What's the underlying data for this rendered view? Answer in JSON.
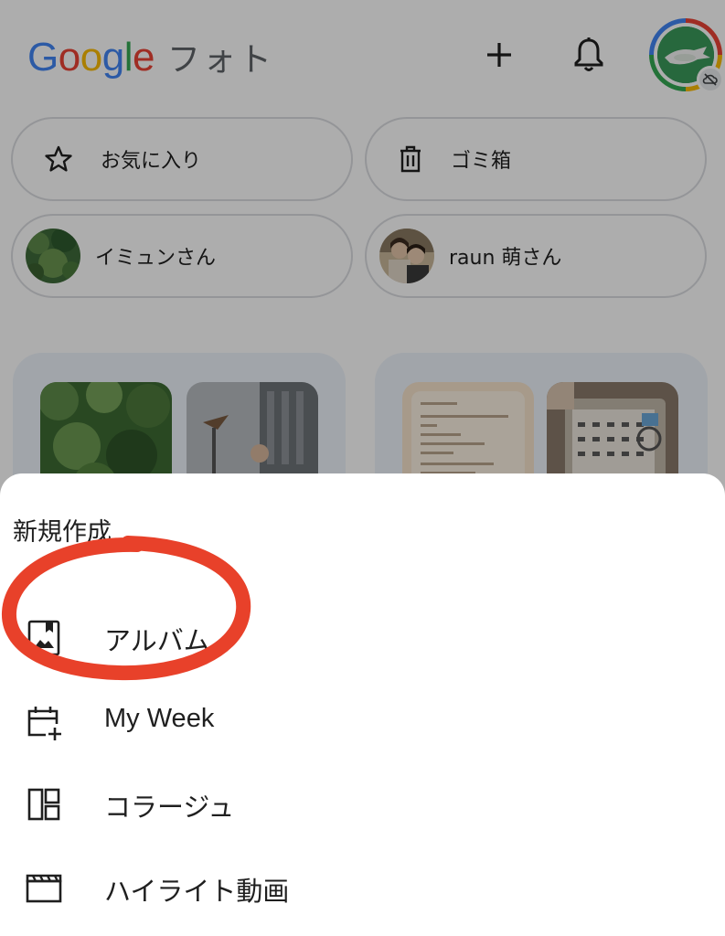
{
  "header": {
    "logo": {
      "letters": [
        {
          "ch": "G",
          "color": "#4285f4"
        },
        {
          "ch": "o",
          "color": "#ea4335"
        },
        {
          "ch": "o",
          "color": "#fbbc05"
        },
        {
          "ch": "g",
          "color": "#4285f4"
        },
        {
          "ch": "l",
          "color": "#34a853"
        },
        {
          "ch": "e",
          "color": "#ea4335"
        }
      ],
      "suffix": "フォト"
    },
    "add_icon": "plus-icon",
    "notifications_icon": "bell-icon"
  },
  "chips": {
    "favorites": {
      "label": "お気に入り",
      "icon": "star-icon"
    },
    "trash": {
      "label": "ゴミ箱",
      "icon": "trash-icon"
    },
    "person1": {
      "label": "イミュンさん"
    },
    "person2": {
      "label": "raun 萌さん"
    }
  },
  "sheet": {
    "title": "新規作成",
    "items": [
      {
        "label": "アルバム",
        "icon": "album-icon"
      },
      {
        "label": "My Week",
        "icon": "calendar-add-icon"
      },
      {
        "label": "コラージュ",
        "icon": "collage-icon"
      },
      {
        "label": "ハイライト動画",
        "icon": "movie-icon"
      }
    ]
  },
  "colors": {
    "annotation": "#e8412a",
    "scrim": "rgba(0,0,0,0.32)"
  }
}
